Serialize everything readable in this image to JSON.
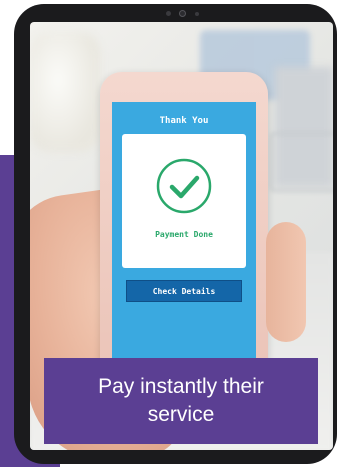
{
  "phone": {
    "heading": "Thank You",
    "status": "Payment Done",
    "button_label": "Check Details"
  },
  "caption": {
    "text": "Pay instantly their service"
  },
  "colors": {
    "brand_purple": "#5b3f93",
    "phone_screen_blue": "#3aa9e0",
    "button_blue": "#1466a8",
    "success_green": "#2aa86b"
  },
  "icons": {
    "status_icon": "check-circle-icon"
  }
}
